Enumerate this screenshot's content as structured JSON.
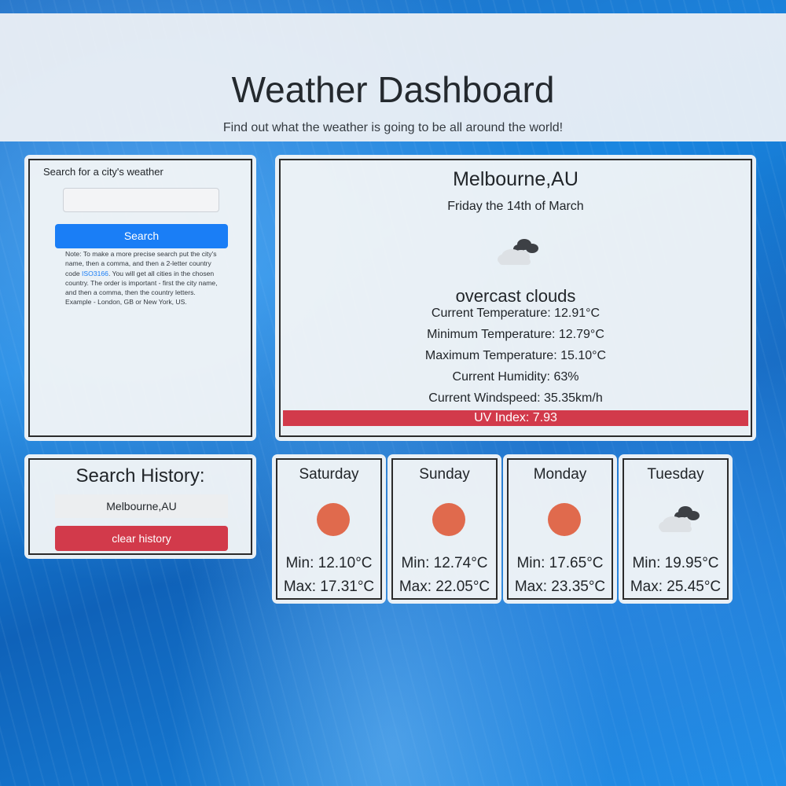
{
  "header": {
    "title": "Weather Dashboard",
    "subtitle": "Find out what the weather is going to be all around the world!"
  },
  "search": {
    "label": "Search for a city's weather",
    "input_value": "",
    "button_label": "Search",
    "note_before_link": "Note: To make a more precise search put the city's name, then a comma, and then a 2-letter country code ",
    "note_link": "ISO3166",
    "note_after_link": ". You will get all cities in the chosen country. The order is important - first the city name, and then a comma, then the country letters. Example - London, GB or New York, US."
  },
  "current": {
    "city": "Melbourne,AU",
    "date": "Friday the 14th of March",
    "icon": "cloud-icon",
    "description": "overcast clouds",
    "temperature": "Current Temperature: 12.91°C",
    "min_temperature": "Minimum Temperature: 12.79°C",
    "max_temperature": "Maximum Temperature: 15.10°C",
    "humidity": "Current Humidity: 63%",
    "windspeed": "Current Windspeed: 35.35km/h",
    "uv_index": "UV Index: 7.93",
    "uv_color": "#d23a4b"
  },
  "history": {
    "title": "Search History:",
    "items": [
      "Melbourne,AU"
    ],
    "clear_label": "clear history"
  },
  "forecast": [
    {
      "day": "Saturday",
      "icon": "sun-icon",
      "min": "Min: 12.10°C",
      "max": "Max: 17.31°C"
    },
    {
      "day": "Sunday",
      "icon": "sun-icon",
      "min": "Min: 12.74°C",
      "max": "Max: 22.05°C"
    },
    {
      "day": "Monday",
      "icon": "sun-icon",
      "min": "Min: 17.65°C",
      "max": "Max: 23.35°C"
    },
    {
      "day": "Tuesday",
      "icon": "cloud-icon",
      "min": "Min: 19.95°C",
      "max": "Max: 25.45°C"
    }
  ],
  "colors": {
    "primary_button": "#1a7ef6",
    "danger": "#d23a4b",
    "sun": "#e06a4d"
  }
}
